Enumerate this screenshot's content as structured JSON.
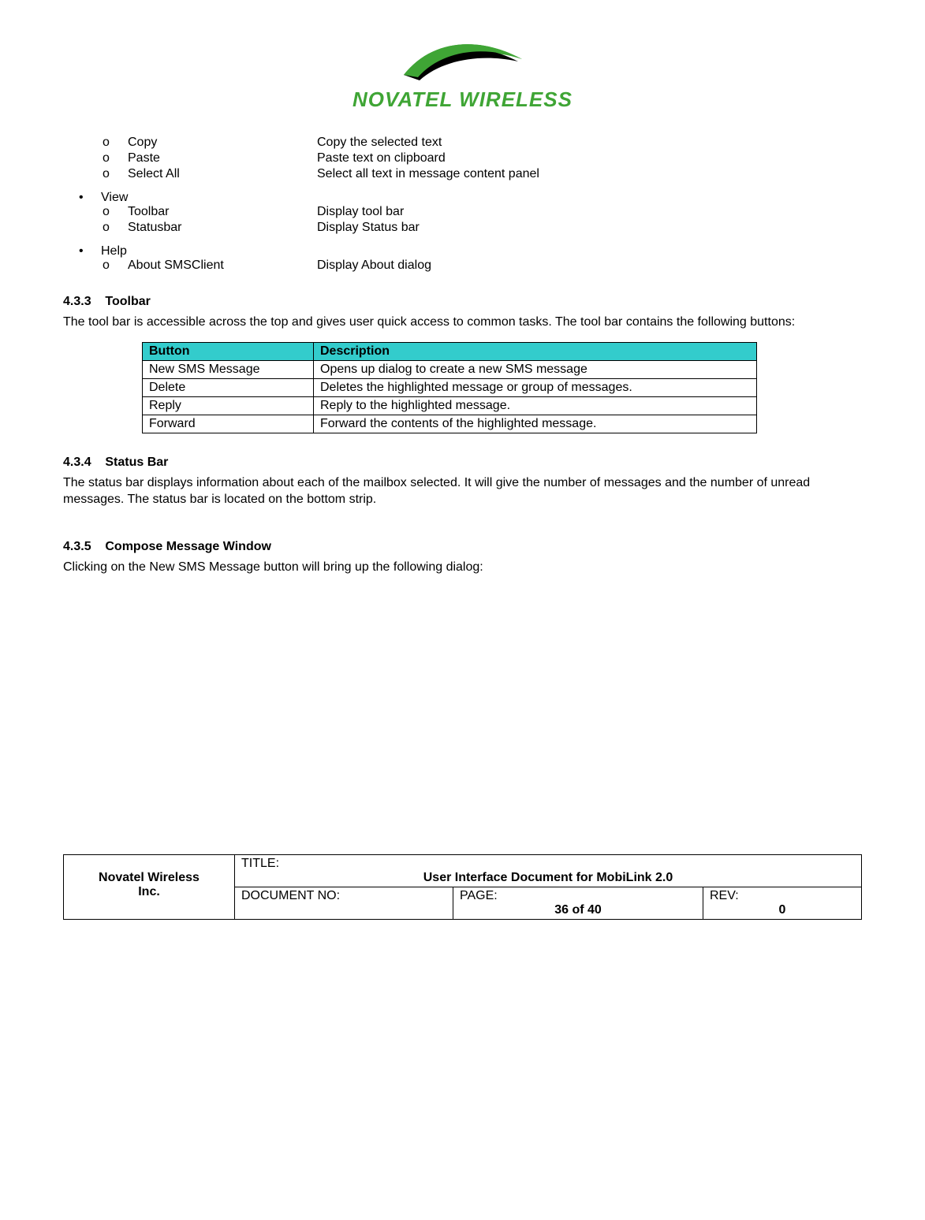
{
  "logo": {
    "text": "NOVATEL WIRELESS"
  },
  "edit_items": [
    {
      "marker": "o",
      "label": "Copy",
      "desc": "Copy the selected text"
    },
    {
      "marker": "o",
      "label": "Paste",
      "desc": "Paste text on clipboard"
    },
    {
      "marker": "o",
      "label": "Select All",
      "desc": "Select all text in message content panel"
    }
  ],
  "view": {
    "label": "View",
    "items": [
      {
        "marker": "o",
        "label": "Toolbar",
        "desc": "Display tool bar"
      },
      {
        "marker": "o",
        "label": "Statusbar",
        "desc": "Display Status bar"
      }
    ]
  },
  "help": {
    "label": "Help",
    "items": [
      {
        "marker": "o",
        "label": "About SMSClient",
        "desc": "Display About dialog"
      }
    ]
  },
  "sec433": {
    "num": "4.3.3",
    "title": "Toolbar",
    "body": "The tool bar is accessible across the top and gives user quick access to common tasks.  The tool bar contains the following buttons:"
  },
  "table": {
    "head": {
      "c1": "Button",
      "c2": "Description"
    },
    "rows": [
      {
        "c1": "New SMS Message",
        "c2": "Opens up dialog to create a new SMS message"
      },
      {
        "c1": "Delete",
        "c2": "Deletes the highlighted message or group of messages."
      },
      {
        "c1": "Reply",
        "c2": "Reply to the highlighted message."
      },
      {
        "c1": "Forward",
        "c2": "Forward the contents of the highlighted message."
      }
    ]
  },
  "sec434": {
    "num": "4.3.4",
    "title": "Status Bar",
    "body": "The status bar displays information about each of the mailbox selected.  It will give the number of messages and the number of unread messages.  The status bar is located on the bottom strip."
  },
  "sec435": {
    "num": "4.3.5",
    "title": "Compose Message Window",
    "body": "Clicking on the New SMS Message button will bring up the following dialog:"
  },
  "footer": {
    "company1": "Novatel Wireless",
    "company2": "Inc.",
    "title_label": "TITLE:",
    "title_value": "User Interface Document for MobiLink 2.0",
    "docno_label": "DOCUMENT NO:",
    "page_label": "PAGE:",
    "page_value": "36 of 40",
    "rev_label": "REV:",
    "rev_value": "0"
  }
}
